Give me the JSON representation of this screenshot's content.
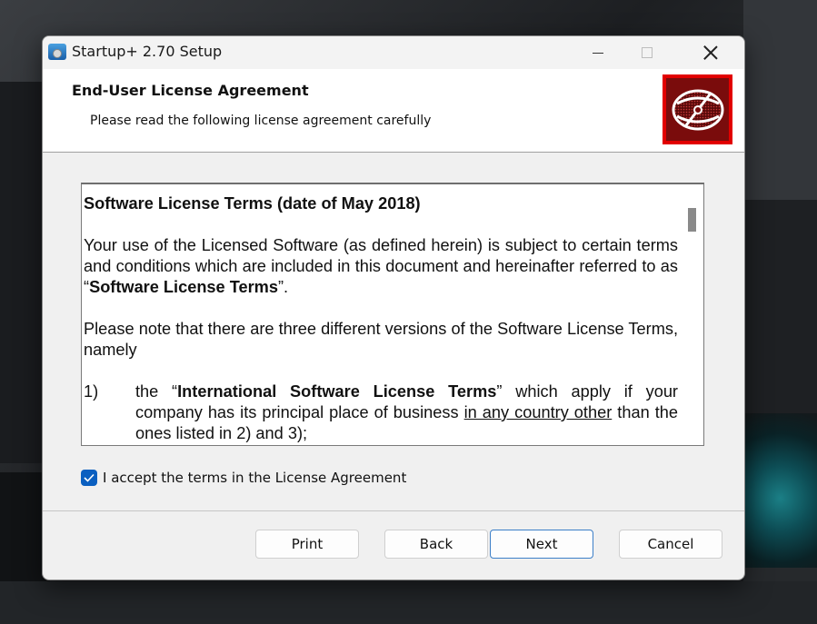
{
  "window": {
    "title": "Startup+ 2.70 Setup",
    "app_icon": "installer-disc-icon",
    "controls": {
      "minimize": "minimize-icon",
      "maximize": "maximize-icon",
      "close": "close-icon"
    }
  },
  "banner": {
    "title": "End-User License Agreement",
    "subtitle": "Please read the following license agreement carefully",
    "logo_icon": "disc-logo-icon",
    "logo_color": "#e20000"
  },
  "license": {
    "heading": "Software License Terms (date of May 2018)",
    "p1_start": "Your use of the Licensed Software (as defined herein) is subject to certain terms and conditions which are included in this document and hereinafter referred to as “",
    "p1_bold": "Software License Terms",
    "p1_end": "”.",
    "p2": "Please note that there are three different versions of the Software License Terms, namely",
    "item1_num": "1)",
    "item1_start": "the “",
    "item1_bold": "International Software License Terms",
    "item1_mid": "” which apply if your company has its principal place of business ",
    "item1_underline": "in any country other",
    "item1_end": " than the ones listed in 2) and 3);"
  },
  "accept": {
    "label": "I accept the terms in the License Agreement",
    "checked": true,
    "accent": "#0a5fc0"
  },
  "buttons": {
    "print": "Print",
    "back": "Back",
    "next": "Next",
    "cancel": "Cancel"
  }
}
